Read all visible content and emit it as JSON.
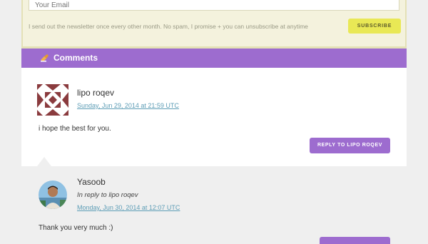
{
  "newsletter": {
    "email_placeholder": "Your Email",
    "note": "I send out the newsletter once every other month. No spam, I promise + you can unsubscribe at anytime",
    "subscribe_label": "SUBSCRIBE"
  },
  "comments": {
    "title": "Comments",
    "icon": "writing-hand-icon",
    "items": [
      {
        "author": "lipo roqev",
        "date": "Sunday, Jun 29, 2014 at 21:59 UTC",
        "text": "i hope the best for you.",
        "reply_label": "REPLY TO LIPO ROQEV",
        "avatar": "identicon-avatar"
      },
      {
        "author": "Yasoob",
        "in_reply_to": "In reply to lipo roqev",
        "date": "Monday, Jun 30, 2014 at 12:07 UTC",
        "text": "Thank you very much :)",
        "avatar": "photo-avatar"
      }
    ]
  },
  "colors": {
    "accent": "#9d6ccf",
    "subscribe": "#e9e855",
    "newsletter_bg": "#f4f2dd",
    "link": "#5d9db6"
  }
}
